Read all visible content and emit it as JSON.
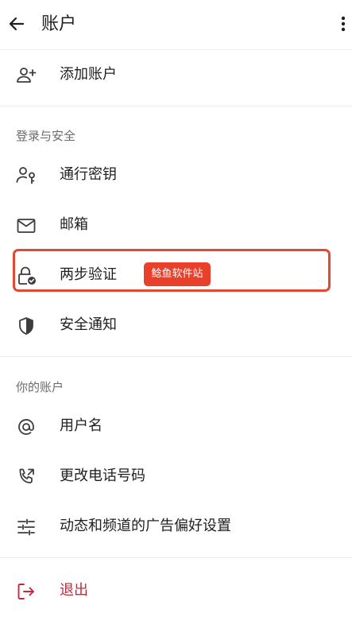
{
  "header": {
    "title": "账户",
    "back_icon": "arrow-left-icon",
    "more_icon": "more-vertical-icon"
  },
  "top_items": [
    {
      "label": "添加账户",
      "icon": "person-add-icon"
    }
  ],
  "sections": [
    {
      "title": "登录与安全",
      "items": [
        {
          "label": "通行密钥",
          "icon": "person-key-icon"
        },
        {
          "label": "邮箱",
          "icon": "mail-icon"
        },
        {
          "label": "两步验证",
          "icon": "lock-check-icon"
        },
        {
          "label": "安全通知",
          "icon": "shield-icon"
        }
      ]
    },
    {
      "title": "你的账户",
      "items": [
        {
          "label": "用户名",
          "icon": "at-sign-icon"
        },
        {
          "label": "更改电话号码",
          "icon": "phone-forward-icon"
        },
        {
          "label": "动态和频道的广告偏好设置",
          "icon": "sliders-icon"
        }
      ]
    }
  ],
  "logout": {
    "label": "退出",
    "icon": "logout-icon",
    "color": "#c8263b"
  },
  "watermark": {
    "text": "鲶鱼软件站",
    "color": "#e8402a"
  },
  "highlight_color": "#e04a32"
}
